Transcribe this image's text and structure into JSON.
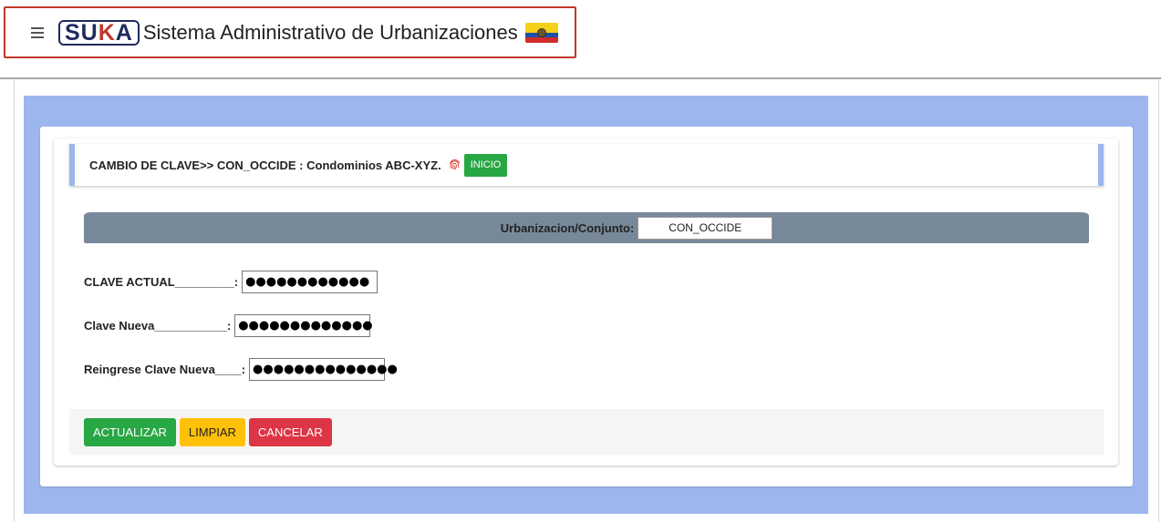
{
  "header": {
    "logo_text": "SUKA",
    "app_title": "Sistema Administrativo de Urbanizaciones",
    "menu_icon": "hamburger-icon",
    "flag_icon": "ecuador-flag-icon"
  },
  "breadcrumb": {
    "text": "CAMBIO DE CLAVE>> CON_OCCIDE : Condominios ABC-XYZ.",
    "icon": "fingerprint-icon",
    "inicio_label": "INICIO"
  },
  "urbanizacion": {
    "label": "Urbanizacion/Conjunto:",
    "value": "CON_OCCIDE"
  },
  "form": {
    "clave_actual_label": "CLAVE ACTUAL_________:",
    "clave_actual_value": "●●●●●●●●●●●●",
    "clave_nueva_label": "Clave Nueva___________:",
    "clave_nueva_value": "●●●●●●●●●●●●●",
    "reingrese_label": "Reingrese Clave Nueva____:",
    "reingrese_value": "●●●●●●●●●●●●●●"
  },
  "buttons": {
    "actualizar": "ACTUALIZAR",
    "limpiar": "LIMPIAR",
    "cancelar": "CANCELAR"
  },
  "colors": {
    "panel_blue": "#9db7ee",
    "success": "#28a745",
    "warning": "#ffc107",
    "danger": "#dc3545",
    "urb_bar": "#778899"
  }
}
